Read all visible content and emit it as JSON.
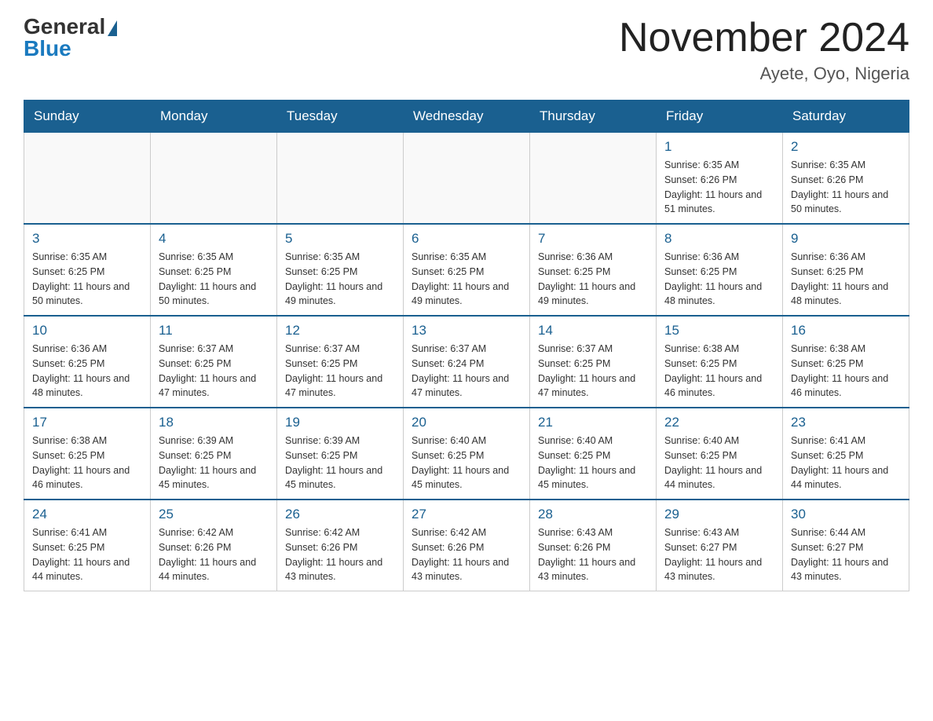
{
  "header": {
    "logo_general": "General",
    "logo_blue": "Blue",
    "title": "November 2024",
    "subtitle": "Ayete, Oyo, Nigeria"
  },
  "weekdays": [
    "Sunday",
    "Monday",
    "Tuesday",
    "Wednesday",
    "Thursday",
    "Friday",
    "Saturday"
  ],
  "weeks": [
    [
      {
        "day": "",
        "info": ""
      },
      {
        "day": "",
        "info": ""
      },
      {
        "day": "",
        "info": ""
      },
      {
        "day": "",
        "info": ""
      },
      {
        "day": "",
        "info": ""
      },
      {
        "day": "1",
        "info": "Sunrise: 6:35 AM\nSunset: 6:26 PM\nDaylight: 11 hours and 51 minutes."
      },
      {
        "day": "2",
        "info": "Sunrise: 6:35 AM\nSunset: 6:26 PM\nDaylight: 11 hours and 50 minutes."
      }
    ],
    [
      {
        "day": "3",
        "info": "Sunrise: 6:35 AM\nSunset: 6:25 PM\nDaylight: 11 hours and 50 minutes."
      },
      {
        "day": "4",
        "info": "Sunrise: 6:35 AM\nSunset: 6:25 PM\nDaylight: 11 hours and 50 minutes."
      },
      {
        "day": "5",
        "info": "Sunrise: 6:35 AM\nSunset: 6:25 PM\nDaylight: 11 hours and 49 minutes."
      },
      {
        "day": "6",
        "info": "Sunrise: 6:35 AM\nSunset: 6:25 PM\nDaylight: 11 hours and 49 minutes."
      },
      {
        "day": "7",
        "info": "Sunrise: 6:36 AM\nSunset: 6:25 PM\nDaylight: 11 hours and 49 minutes."
      },
      {
        "day": "8",
        "info": "Sunrise: 6:36 AM\nSunset: 6:25 PM\nDaylight: 11 hours and 48 minutes."
      },
      {
        "day": "9",
        "info": "Sunrise: 6:36 AM\nSunset: 6:25 PM\nDaylight: 11 hours and 48 minutes."
      }
    ],
    [
      {
        "day": "10",
        "info": "Sunrise: 6:36 AM\nSunset: 6:25 PM\nDaylight: 11 hours and 48 minutes."
      },
      {
        "day": "11",
        "info": "Sunrise: 6:37 AM\nSunset: 6:25 PM\nDaylight: 11 hours and 47 minutes."
      },
      {
        "day": "12",
        "info": "Sunrise: 6:37 AM\nSunset: 6:25 PM\nDaylight: 11 hours and 47 minutes."
      },
      {
        "day": "13",
        "info": "Sunrise: 6:37 AM\nSunset: 6:24 PM\nDaylight: 11 hours and 47 minutes."
      },
      {
        "day": "14",
        "info": "Sunrise: 6:37 AM\nSunset: 6:25 PM\nDaylight: 11 hours and 47 minutes."
      },
      {
        "day": "15",
        "info": "Sunrise: 6:38 AM\nSunset: 6:25 PM\nDaylight: 11 hours and 46 minutes."
      },
      {
        "day": "16",
        "info": "Sunrise: 6:38 AM\nSunset: 6:25 PM\nDaylight: 11 hours and 46 minutes."
      }
    ],
    [
      {
        "day": "17",
        "info": "Sunrise: 6:38 AM\nSunset: 6:25 PM\nDaylight: 11 hours and 46 minutes."
      },
      {
        "day": "18",
        "info": "Sunrise: 6:39 AM\nSunset: 6:25 PM\nDaylight: 11 hours and 45 minutes."
      },
      {
        "day": "19",
        "info": "Sunrise: 6:39 AM\nSunset: 6:25 PM\nDaylight: 11 hours and 45 minutes."
      },
      {
        "day": "20",
        "info": "Sunrise: 6:40 AM\nSunset: 6:25 PM\nDaylight: 11 hours and 45 minutes."
      },
      {
        "day": "21",
        "info": "Sunrise: 6:40 AM\nSunset: 6:25 PM\nDaylight: 11 hours and 45 minutes."
      },
      {
        "day": "22",
        "info": "Sunrise: 6:40 AM\nSunset: 6:25 PM\nDaylight: 11 hours and 44 minutes."
      },
      {
        "day": "23",
        "info": "Sunrise: 6:41 AM\nSunset: 6:25 PM\nDaylight: 11 hours and 44 minutes."
      }
    ],
    [
      {
        "day": "24",
        "info": "Sunrise: 6:41 AM\nSunset: 6:25 PM\nDaylight: 11 hours and 44 minutes."
      },
      {
        "day": "25",
        "info": "Sunrise: 6:42 AM\nSunset: 6:26 PM\nDaylight: 11 hours and 44 minutes."
      },
      {
        "day": "26",
        "info": "Sunrise: 6:42 AM\nSunset: 6:26 PM\nDaylight: 11 hours and 43 minutes."
      },
      {
        "day": "27",
        "info": "Sunrise: 6:42 AM\nSunset: 6:26 PM\nDaylight: 11 hours and 43 minutes."
      },
      {
        "day": "28",
        "info": "Sunrise: 6:43 AM\nSunset: 6:26 PM\nDaylight: 11 hours and 43 minutes."
      },
      {
        "day": "29",
        "info": "Sunrise: 6:43 AM\nSunset: 6:27 PM\nDaylight: 11 hours and 43 minutes."
      },
      {
        "day": "30",
        "info": "Sunrise: 6:44 AM\nSunset: 6:27 PM\nDaylight: 11 hours and 43 minutes."
      }
    ]
  ]
}
